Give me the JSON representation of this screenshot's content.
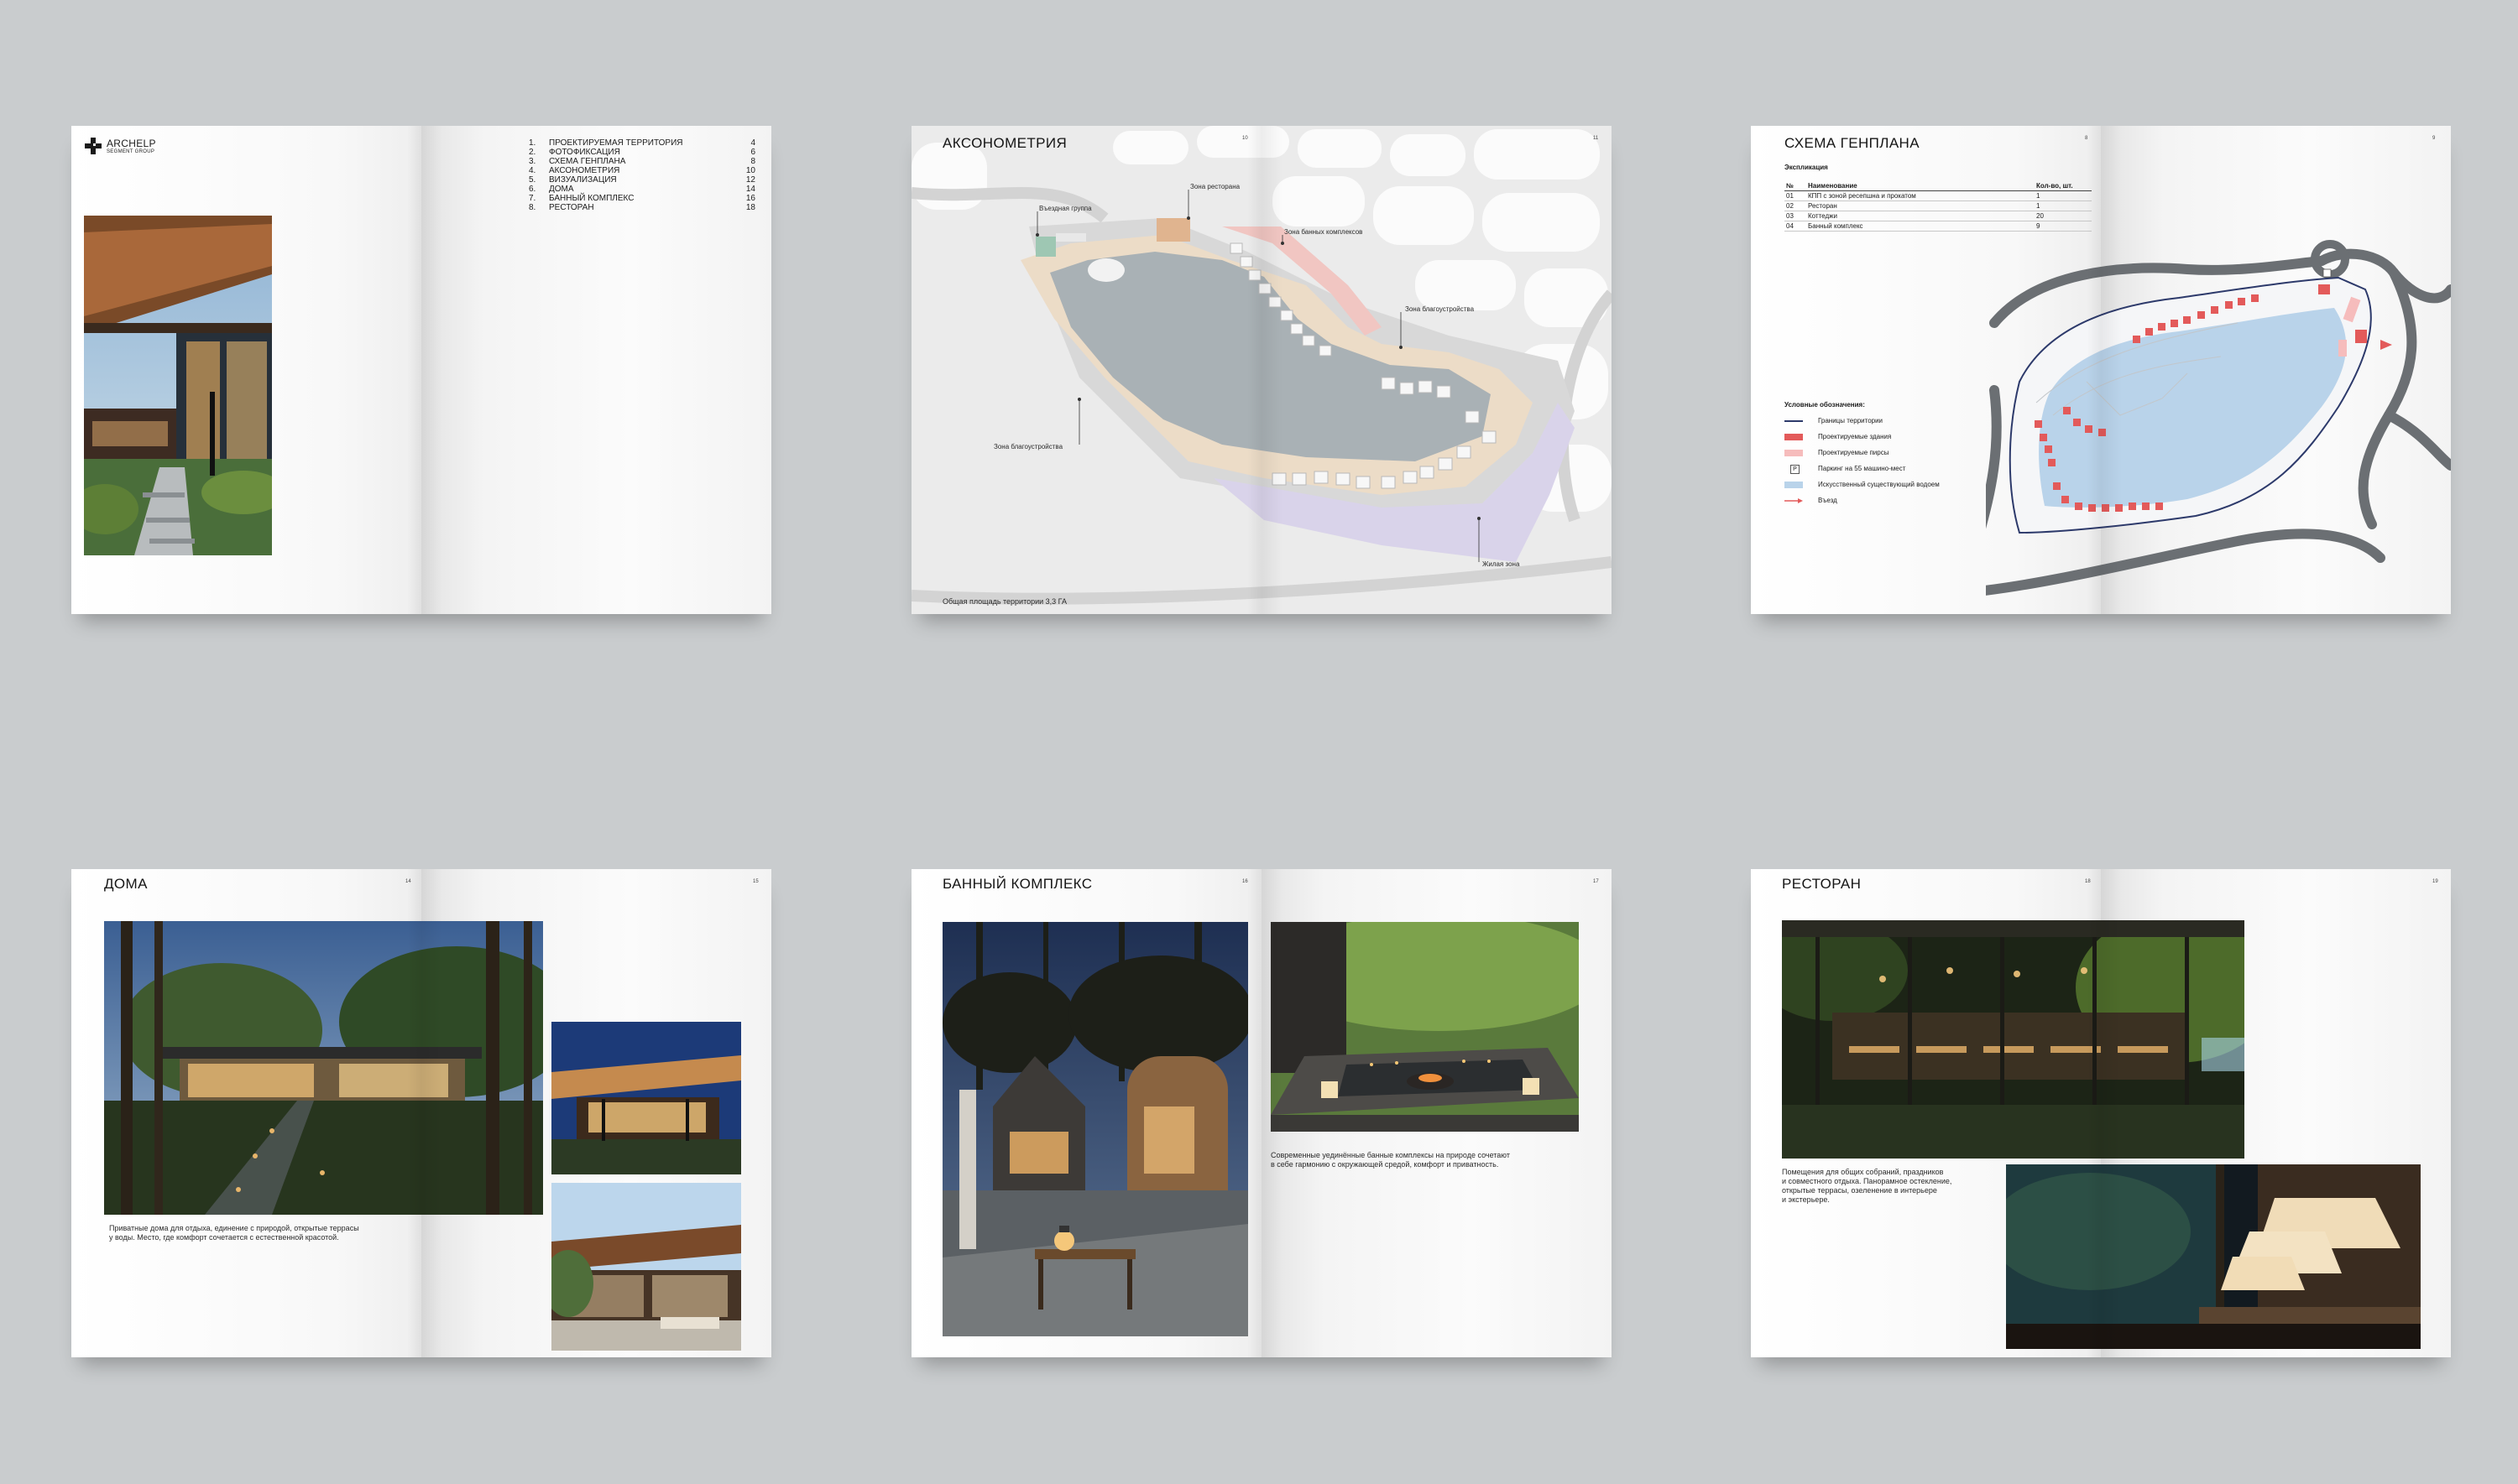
{
  "spread1": {
    "logo_name": "ARCHELP",
    "logo_sub": "SEGMENT GROUP",
    "toc": [
      {
        "num": "1.",
        "label": "ПРОЕКТИРУЕМАЯ ТЕРРИТОРИЯ",
        "page": "4"
      },
      {
        "num": "2.",
        "label": "ФОТОФИКСАЦИЯ",
        "page": "6"
      },
      {
        "num": "3.",
        "label": "СХЕМА ГЕНПЛАНА",
        "page": "8"
      },
      {
        "num": "4.",
        "label": "АКСОНОМЕТРИЯ",
        "page": "10"
      },
      {
        "num": "5.",
        "label": "ВИЗУАЛИЗАЦИЯ",
        "page": "12"
      },
      {
        "num": "6.",
        "label": "ДОМА",
        "page": "14"
      },
      {
        "num": "7.",
        "label": "БАННЫЙ КОМПЛЕКС",
        "page": "16"
      },
      {
        "num": "8.",
        "label": "РЕСТОРАН",
        "page": "18"
      }
    ]
  },
  "spread2": {
    "title": "АКСОНОМЕТРИЯ",
    "page_left": "10",
    "page_right": "11",
    "labels": {
      "entry": "Въездная группа",
      "restaurant": "Зона ресторана",
      "bath": "Зона банных комплексов",
      "landscape_right": "Зона благоустройства",
      "landscape_left": "Зона благоустройства",
      "living": "Жилая зона"
    },
    "area": "Общая площадь территории 3,3 ГА"
  },
  "spread3": {
    "title": "СХЕМА ГЕНПЛАНА",
    "page_left": "8",
    "page_right": "9",
    "expl_title": "Экспликация",
    "expl_headers": [
      "№",
      "Наименование",
      "Кол-во, шт."
    ],
    "expl_rows": [
      [
        "01",
        "КПП с зоной ресепшна и прокатом",
        "1"
      ],
      [
        "02",
        "Ресторан",
        "1"
      ],
      [
        "03",
        "Коттеджи",
        "20"
      ],
      [
        "04",
        "Банный комплекс",
        "9"
      ]
    ],
    "legend_title": "Условные обозначения:",
    "legend": [
      {
        "label": "Границы территории",
        "color": "#2d3a6b"
      },
      {
        "label": "Проектируемые здания",
        "color": "#e35a5a"
      },
      {
        "label": "Проектируемые пирсы",
        "color": "#f6bcbc"
      },
      {
        "label": "Паркинг на 55 машино-мест",
        "color": "#9aa3aa"
      },
      {
        "label": "Искусственный существующий водоем",
        "color": "#b9d3ea"
      },
      {
        "label": "Въезд",
        "color": "#e35a5a"
      }
    ],
    "parking_mark": "P"
  },
  "spread4": {
    "title": "ДОМА",
    "page_left": "14",
    "page_right": "15",
    "caption_line1": "Приватные дома для отдыха, единение с природой, открытые террасы",
    "caption_line2": "у воды. Место, где комфорт сочетается с естественной красотой."
  },
  "spread5": {
    "title": "БАННЫЙ КОМПЛЕКС",
    "page_left": "16",
    "page_right": "17",
    "caption_line1": "Современные уединённые банные комплексы на природе сочетают",
    "caption_line2": "в себе гармонию с окружающей средой, комфорт и приватность."
  },
  "spread6": {
    "title": "РЕСТОРАН",
    "page_left": "18",
    "page_right": "19",
    "caption_line1": "Помещения для общих собраний, праздников",
    "caption_line2": "и совместного отдыха. Панорамное остекление,",
    "caption_line3": "открытые террасы, озеленение в интерьере",
    "caption_line4": "и экстерьере."
  },
  "colors": {
    "background": "#c9ccce",
    "water": "#b9d3ea",
    "building_red": "#e35a5a",
    "boundary": "#2d3a6b"
  }
}
